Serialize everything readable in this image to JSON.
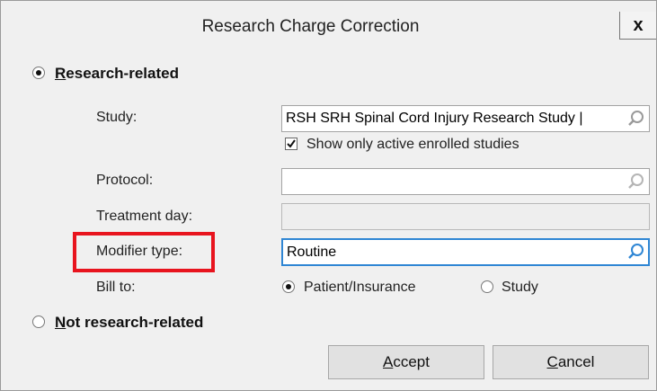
{
  "window": {
    "title": "Research Charge Correction",
    "close_label": "x"
  },
  "research_related": {
    "label_first": "R",
    "label_rest": "esearch-related",
    "selected": true
  },
  "study": {
    "label": "Study:",
    "value": "RSH SRH Spinal Cord Injury Research Study |",
    "show_active": {
      "label": "Show only active enrolled studies",
      "checked": true
    }
  },
  "protocol": {
    "label": "Protocol:",
    "value": ""
  },
  "treatment_day": {
    "label": "Treatment day:",
    "value": ""
  },
  "modifier_type": {
    "label": "Modifier type:",
    "value": "Routine",
    "highlight_color": "#e8141e"
  },
  "bill_to": {
    "label": "Bill to:",
    "options": [
      {
        "label": "Patient/Insurance",
        "selected": true
      },
      {
        "label": "Study",
        "selected": false
      }
    ]
  },
  "not_research_related": {
    "label_first": "N",
    "label_rest": "ot research-related",
    "selected": false
  },
  "buttons": {
    "accept": {
      "label_first": "A",
      "label_rest": "ccept"
    },
    "cancel": {
      "label_first": "C",
      "label_rest": "ancel"
    }
  },
  "colors": {
    "focus": "#2f86d4",
    "highlight": "#e8141e",
    "background": "#f0f0f0"
  }
}
